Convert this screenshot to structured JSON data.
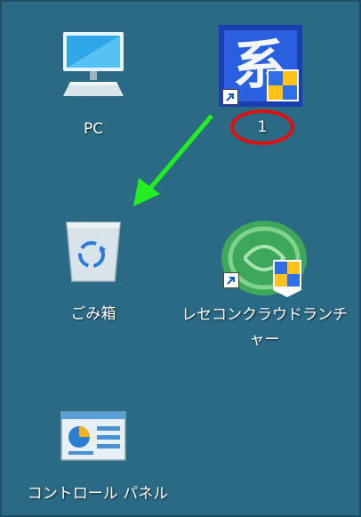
{
  "desktop": {
    "background": "#2b6a85",
    "icons": [
      {
        "label": "PC",
        "icon": "monitor-pc-icon"
      },
      {
        "label": "1",
        "icon": "app-shortcut-icon"
      },
      {
        "label": "ごみ箱",
        "icon": "recycle-bin-icon"
      },
      {
        "label": "レセコンクラウドランチャー",
        "label_line1": "レセコンクラウドランチ",
        "label_line2": "ャー",
        "icon": "launcher-shortcut-icon"
      },
      {
        "label": "コントロール パネル",
        "icon": "control-panel-icon"
      }
    ]
  },
  "annotations": {
    "arrow_color": "#22ee22",
    "circle_color": "#e01010"
  }
}
